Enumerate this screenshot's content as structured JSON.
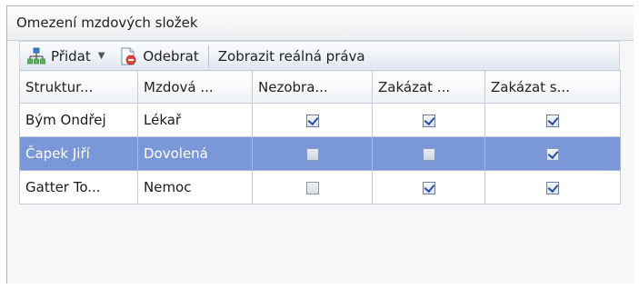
{
  "panel": {
    "title": "Omezení mzdových složek"
  },
  "toolbar": {
    "add_label": "Přidat",
    "add_icon": "structure-icon",
    "remove_label": "Odebrat",
    "remove_icon": "document-remove-icon",
    "show_rights_label": "Zobrazit reálná práva"
  },
  "grid": {
    "columns": [
      "Struktur...",
      "Mzdová ...",
      "Nezobra...",
      "Zakázat ...",
      "Zakázat s..."
    ],
    "rows": [
      {
        "name": "Bým Ondřej",
        "component": "Lékař",
        "hide": true,
        "forbid1": true,
        "forbid2": true,
        "selected": false
      },
      {
        "name": "Čapek Jiří",
        "component": "Dovolená",
        "hide": false,
        "forbid1": false,
        "forbid2": true,
        "selected": true
      },
      {
        "name": "Gatter To...",
        "component": "Nemoc",
        "hide": false,
        "forbid1": true,
        "forbid2": true,
        "selected": false
      }
    ]
  },
  "colors": {
    "selection": "#7a97d8",
    "accent": "#2a4f9e"
  }
}
